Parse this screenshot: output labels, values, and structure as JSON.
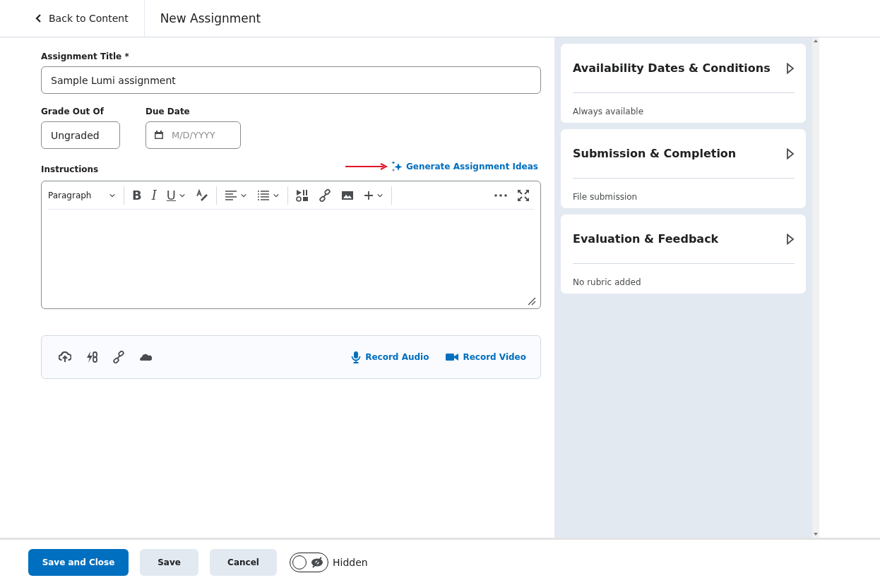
{
  "header": {
    "back_link": "Back to Content",
    "title": "New Assignment"
  },
  "form": {
    "title_field": {
      "label": "Assignment Title *",
      "value": "Sample Lumi assignment"
    },
    "grade_field": {
      "label": "Grade Out Of",
      "value": "Ungraded"
    },
    "due_date_field": {
      "label": "Due Date",
      "placeholder": "M/D/YYYY"
    },
    "instructions": {
      "label": "Instructions",
      "generate_link": "Generate Assignment Ideas",
      "editor": {
        "format_select": "Paragraph",
        "text_buttons": [
          {
            "kind": "bold",
            "label": "B",
            "dropdown": false
          },
          {
            "kind": "italic",
            "label": "I",
            "dropdown": false
          },
          {
            "kind": "underline",
            "label": "U",
            "dropdown": true
          }
        ]
      }
    },
    "attachments": {
      "record_audio": "Record Audio",
      "record_video": "Record Video"
    }
  },
  "side_panels": [
    {
      "title": "Availability Dates & Conditions",
      "summary": "Always available",
      "expanded": false
    },
    {
      "title": "Submission & Completion",
      "summary": "File submission",
      "expanded": false
    },
    {
      "title": "Evaluation & Feedback",
      "summary": "No rubric added",
      "expanded": false
    }
  ],
  "footer": {
    "buttons": [
      {
        "label": "Save and Close",
        "kind": "primary"
      },
      {
        "label": "Save",
        "kind": "secondary"
      },
      {
        "label": "Cancel",
        "kind": "secondary"
      }
    ],
    "visibility_toggle": {
      "label": "Hidden",
      "on": false
    }
  }
}
